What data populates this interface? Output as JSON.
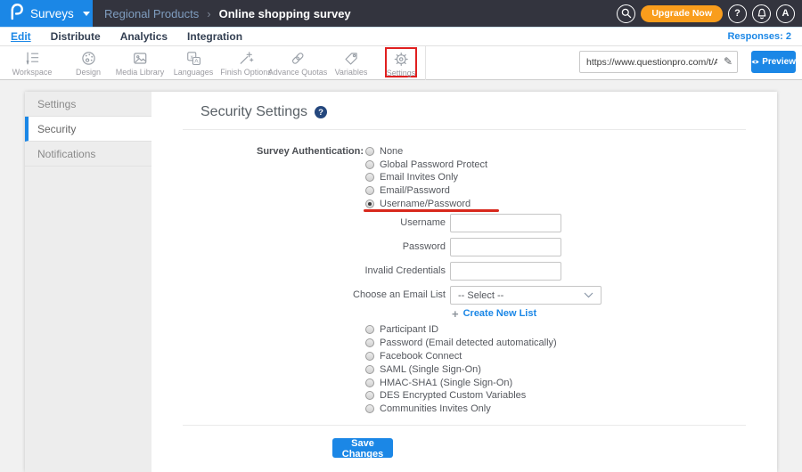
{
  "topbar": {
    "brand_label": "Surveys",
    "breadcrumb": {
      "folder": "Regional Products",
      "separator": "›",
      "title": "Online shopping survey"
    },
    "upgrade_label": "Upgrade Now",
    "help_label": "?",
    "avatar_label": "A"
  },
  "nav": {
    "tabs": [
      {
        "label": "Edit",
        "active": true
      },
      {
        "label": "Distribute",
        "active": false
      },
      {
        "label": "Analytics",
        "active": false
      },
      {
        "label": "Integration",
        "active": false
      }
    ],
    "responses_label": "Responses: 2"
  },
  "toolbar": {
    "items": [
      {
        "label": "Workspace"
      },
      {
        "label": "Design"
      },
      {
        "label": "Media Library"
      },
      {
        "label": "Languages"
      },
      {
        "label": "Finish Options"
      },
      {
        "label": "Advance Quotas"
      },
      {
        "label": "Variables"
      },
      {
        "label": "Settings",
        "highlighted": true
      }
    ],
    "url": "https://www.questionpro.com/t/APNrFZ",
    "preview_label": "Preview"
  },
  "sidebar": {
    "items": [
      {
        "label": "Settings",
        "active": false
      },
      {
        "label": "Security",
        "active": true
      },
      {
        "label": "Notifications",
        "active": false
      }
    ]
  },
  "main": {
    "heading": "Security Settings",
    "help_label": "?",
    "auth_label": "Survey Authentication:",
    "auth_top": [
      "None",
      "Global Password Protect",
      "Email Invites Only",
      "Email/Password",
      "Username/Password"
    ],
    "selected_option": "Username/Password",
    "field_labels": [
      "Username",
      "Password",
      "Invalid Credentials"
    ],
    "email_list": {
      "label": "Choose an Email List",
      "value": "-- Select --"
    },
    "create_link_plus": "+",
    "create_link_label": "Create New List",
    "auth_bottom": [
      "Participant ID",
      "Password (Email detected automatically)",
      "Facebook Connect",
      "SAML (Single Sign-On)",
      "HMAC-SHA1 (Single Sign-On)",
      "DES Encrypted Custom Variables",
      "Communities Invites Only"
    ],
    "save_label": "Save Changes"
  },
  "annotations": {
    "toolbar_highlighted_item": "Settings",
    "underlined_option": "Username/Password",
    "highlight_color": "#e02020"
  },
  "colors": {
    "accent_blue": "#1b87e6",
    "topbar_dark": "#33343e",
    "upgrade_orange": "#f99d1c",
    "annotation_red": "#e02020"
  }
}
